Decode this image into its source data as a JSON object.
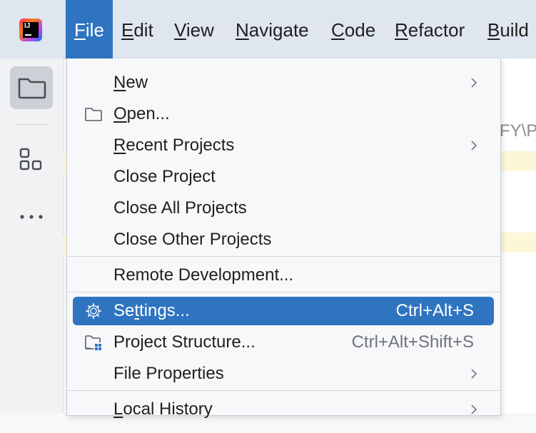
{
  "menubar": {
    "items": [
      {
        "pre": "",
        "mn": "F",
        "post": "ile"
      },
      {
        "pre": "",
        "mn": "E",
        "post": "dit"
      },
      {
        "pre": "",
        "mn": "V",
        "post": "iew"
      },
      {
        "pre": "",
        "mn": "N",
        "post": "avigate"
      },
      {
        "pre": "",
        "mn": "C",
        "post": "ode"
      },
      {
        "pre": "",
        "mn": "R",
        "post": "efactor"
      },
      {
        "pre": "",
        "mn": "B",
        "post": "uild"
      }
    ]
  },
  "logo": {
    "text": "IJ"
  },
  "editor": {
    "hint": "FY\\P"
  },
  "file_menu": {
    "new": {
      "pre": "",
      "mn": "N",
      "post": "ew"
    },
    "open": {
      "pre": "",
      "mn": "O",
      "post": "pen..."
    },
    "recent": {
      "pre": "",
      "mn": "R",
      "post": "ecent Projects"
    },
    "close_project": {
      "pre": "Close Pro",
      "mn": "j",
      "post": "ect"
    },
    "close_all": {
      "pre": "Close All Projects",
      "mn": "",
      "post": ""
    },
    "close_other": {
      "pre": "Close Other Projects",
      "mn": "",
      "post": ""
    },
    "remote": {
      "pre": "Remote Development...",
      "mn": "",
      "post": ""
    },
    "settings": {
      "pre": "Se",
      "mn": "t",
      "post": "tings...",
      "shortcut": "Ctrl+Alt+S"
    },
    "project_structure": {
      "pre": "Project Structure...",
      "mn": "",
      "post": "",
      "shortcut": "Ctrl+Alt+Shift+S"
    },
    "file_properties": {
      "pre": "File Properties",
      "mn": "",
      "post": ""
    },
    "local_history": {
      "pre": "",
      "mn": "L",
      "post": "ocal History"
    }
  },
  "colors": {
    "accent": "#2f74c0",
    "menubar_bg": "#dfe6f0"
  },
  "icons": [
    "folder-icon",
    "structure-icon",
    "more-icon",
    "gear-icon",
    "project-structure-icon",
    "chevron-right-icon"
  ]
}
